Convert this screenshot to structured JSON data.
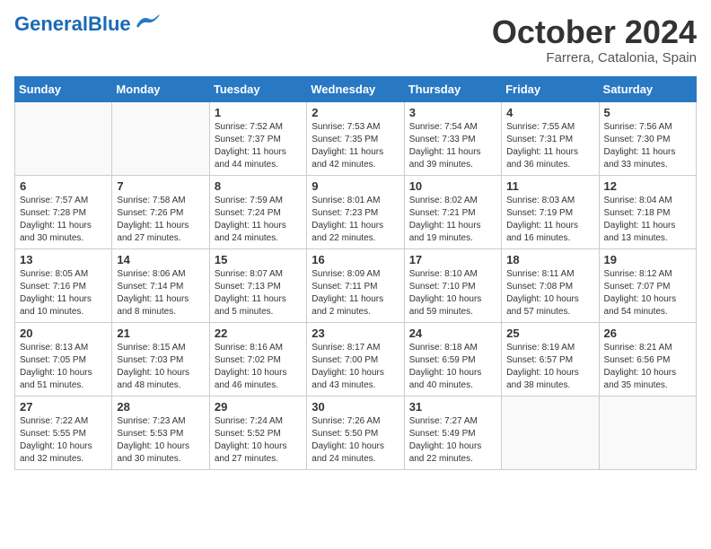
{
  "header": {
    "logo_general": "General",
    "logo_blue": "Blue",
    "month": "October 2024",
    "location": "Farrera, Catalonia, Spain"
  },
  "weekdays": [
    "Sunday",
    "Monday",
    "Tuesday",
    "Wednesday",
    "Thursday",
    "Friday",
    "Saturday"
  ],
  "weeks": [
    [
      {
        "num": "",
        "info": ""
      },
      {
        "num": "",
        "info": ""
      },
      {
        "num": "1",
        "info": "Sunrise: 7:52 AM\nSunset: 7:37 PM\nDaylight: 11 hours and 44 minutes."
      },
      {
        "num": "2",
        "info": "Sunrise: 7:53 AM\nSunset: 7:35 PM\nDaylight: 11 hours and 42 minutes."
      },
      {
        "num": "3",
        "info": "Sunrise: 7:54 AM\nSunset: 7:33 PM\nDaylight: 11 hours and 39 minutes."
      },
      {
        "num": "4",
        "info": "Sunrise: 7:55 AM\nSunset: 7:31 PM\nDaylight: 11 hours and 36 minutes."
      },
      {
        "num": "5",
        "info": "Sunrise: 7:56 AM\nSunset: 7:30 PM\nDaylight: 11 hours and 33 minutes."
      }
    ],
    [
      {
        "num": "6",
        "info": "Sunrise: 7:57 AM\nSunset: 7:28 PM\nDaylight: 11 hours and 30 minutes."
      },
      {
        "num": "7",
        "info": "Sunrise: 7:58 AM\nSunset: 7:26 PM\nDaylight: 11 hours and 27 minutes."
      },
      {
        "num": "8",
        "info": "Sunrise: 7:59 AM\nSunset: 7:24 PM\nDaylight: 11 hours and 24 minutes."
      },
      {
        "num": "9",
        "info": "Sunrise: 8:01 AM\nSunset: 7:23 PM\nDaylight: 11 hours and 22 minutes."
      },
      {
        "num": "10",
        "info": "Sunrise: 8:02 AM\nSunset: 7:21 PM\nDaylight: 11 hours and 19 minutes."
      },
      {
        "num": "11",
        "info": "Sunrise: 8:03 AM\nSunset: 7:19 PM\nDaylight: 11 hours and 16 minutes."
      },
      {
        "num": "12",
        "info": "Sunrise: 8:04 AM\nSunset: 7:18 PM\nDaylight: 11 hours and 13 minutes."
      }
    ],
    [
      {
        "num": "13",
        "info": "Sunrise: 8:05 AM\nSunset: 7:16 PM\nDaylight: 11 hours and 10 minutes."
      },
      {
        "num": "14",
        "info": "Sunrise: 8:06 AM\nSunset: 7:14 PM\nDaylight: 11 hours and 8 minutes."
      },
      {
        "num": "15",
        "info": "Sunrise: 8:07 AM\nSunset: 7:13 PM\nDaylight: 11 hours and 5 minutes."
      },
      {
        "num": "16",
        "info": "Sunrise: 8:09 AM\nSunset: 7:11 PM\nDaylight: 11 hours and 2 minutes."
      },
      {
        "num": "17",
        "info": "Sunrise: 8:10 AM\nSunset: 7:10 PM\nDaylight: 10 hours and 59 minutes."
      },
      {
        "num": "18",
        "info": "Sunrise: 8:11 AM\nSunset: 7:08 PM\nDaylight: 10 hours and 57 minutes."
      },
      {
        "num": "19",
        "info": "Sunrise: 8:12 AM\nSunset: 7:07 PM\nDaylight: 10 hours and 54 minutes."
      }
    ],
    [
      {
        "num": "20",
        "info": "Sunrise: 8:13 AM\nSunset: 7:05 PM\nDaylight: 10 hours and 51 minutes."
      },
      {
        "num": "21",
        "info": "Sunrise: 8:15 AM\nSunset: 7:03 PM\nDaylight: 10 hours and 48 minutes."
      },
      {
        "num": "22",
        "info": "Sunrise: 8:16 AM\nSunset: 7:02 PM\nDaylight: 10 hours and 46 minutes."
      },
      {
        "num": "23",
        "info": "Sunrise: 8:17 AM\nSunset: 7:00 PM\nDaylight: 10 hours and 43 minutes."
      },
      {
        "num": "24",
        "info": "Sunrise: 8:18 AM\nSunset: 6:59 PM\nDaylight: 10 hours and 40 minutes."
      },
      {
        "num": "25",
        "info": "Sunrise: 8:19 AM\nSunset: 6:57 PM\nDaylight: 10 hours and 38 minutes."
      },
      {
        "num": "26",
        "info": "Sunrise: 8:21 AM\nSunset: 6:56 PM\nDaylight: 10 hours and 35 minutes."
      }
    ],
    [
      {
        "num": "27",
        "info": "Sunrise: 7:22 AM\nSunset: 5:55 PM\nDaylight: 10 hours and 32 minutes."
      },
      {
        "num": "28",
        "info": "Sunrise: 7:23 AM\nSunset: 5:53 PM\nDaylight: 10 hours and 30 minutes."
      },
      {
        "num": "29",
        "info": "Sunrise: 7:24 AM\nSunset: 5:52 PM\nDaylight: 10 hours and 27 minutes."
      },
      {
        "num": "30",
        "info": "Sunrise: 7:26 AM\nSunset: 5:50 PM\nDaylight: 10 hours and 24 minutes."
      },
      {
        "num": "31",
        "info": "Sunrise: 7:27 AM\nSunset: 5:49 PM\nDaylight: 10 hours and 22 minutes."
      },
      {
        "num": "",
        "info": ""
      },
      {
        "num": "",
        "info": ""
      }
    ]
  ]
}
